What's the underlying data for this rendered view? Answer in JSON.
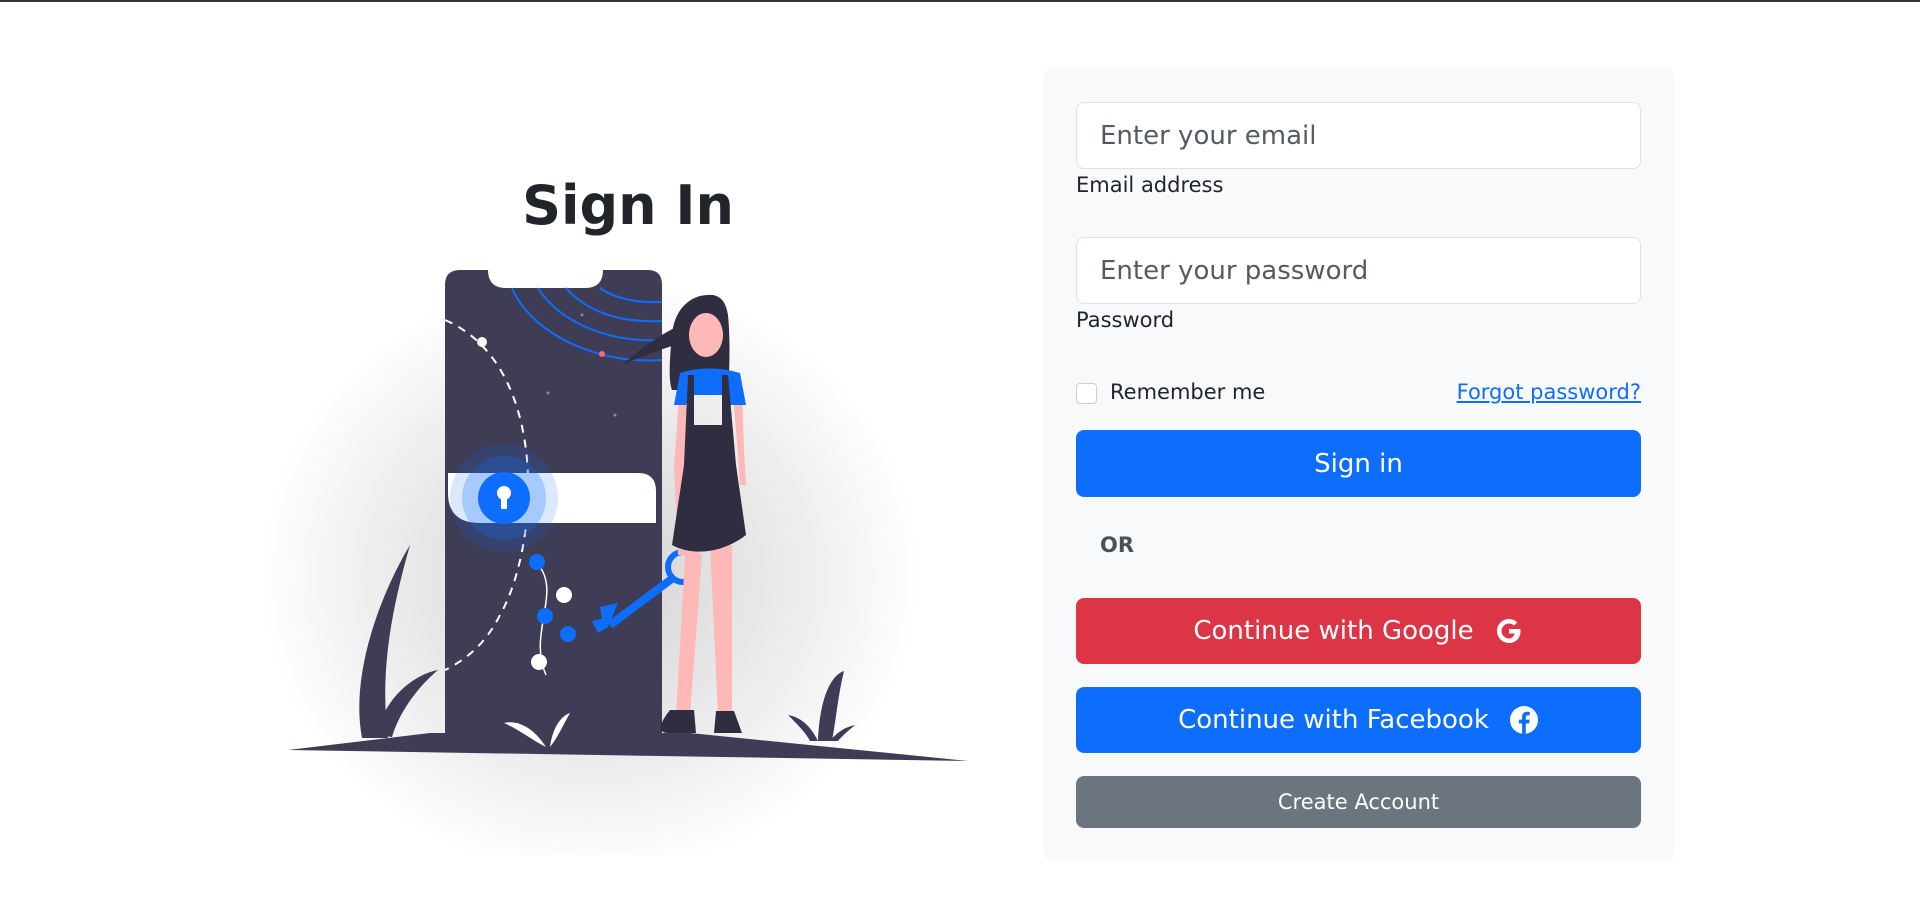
{
  "page": {
    "title": "Sign In"
  },
  "form": {
    "email": {
      "placeholder": "Enter your email",
      "value": "",
      "label": "Email address"
    },
    "password": {
      "placeholder": "Enter your password",
      "value": "",
      "label": "Password"
    },
    "remember_label": "Remember me",
    "remember_checked": false,
    "forgot_label": "Forgot password?",
    "sign_in_label": "Sign in",
    "or_label": "OR",
    "google_label": "Continue with Google",
    "facebook_label": "Continue with Facebook",
    "create_account_label": "Create Account"
  },
  "icons": {
    "google": "google-icon",
    "facebook": "facebook-icon",
    "padlock": "keyhole-icon"
  },
  "colors": {
    "primary": "#0d6efd",
    "danger": "#dc3545",
    "secondary": "#6c757d",
    "card_bg": "#f8f9fa",
    "illustration_dark": "#3f3d56",
    "skin": "#ffb8b8"
  }
}
